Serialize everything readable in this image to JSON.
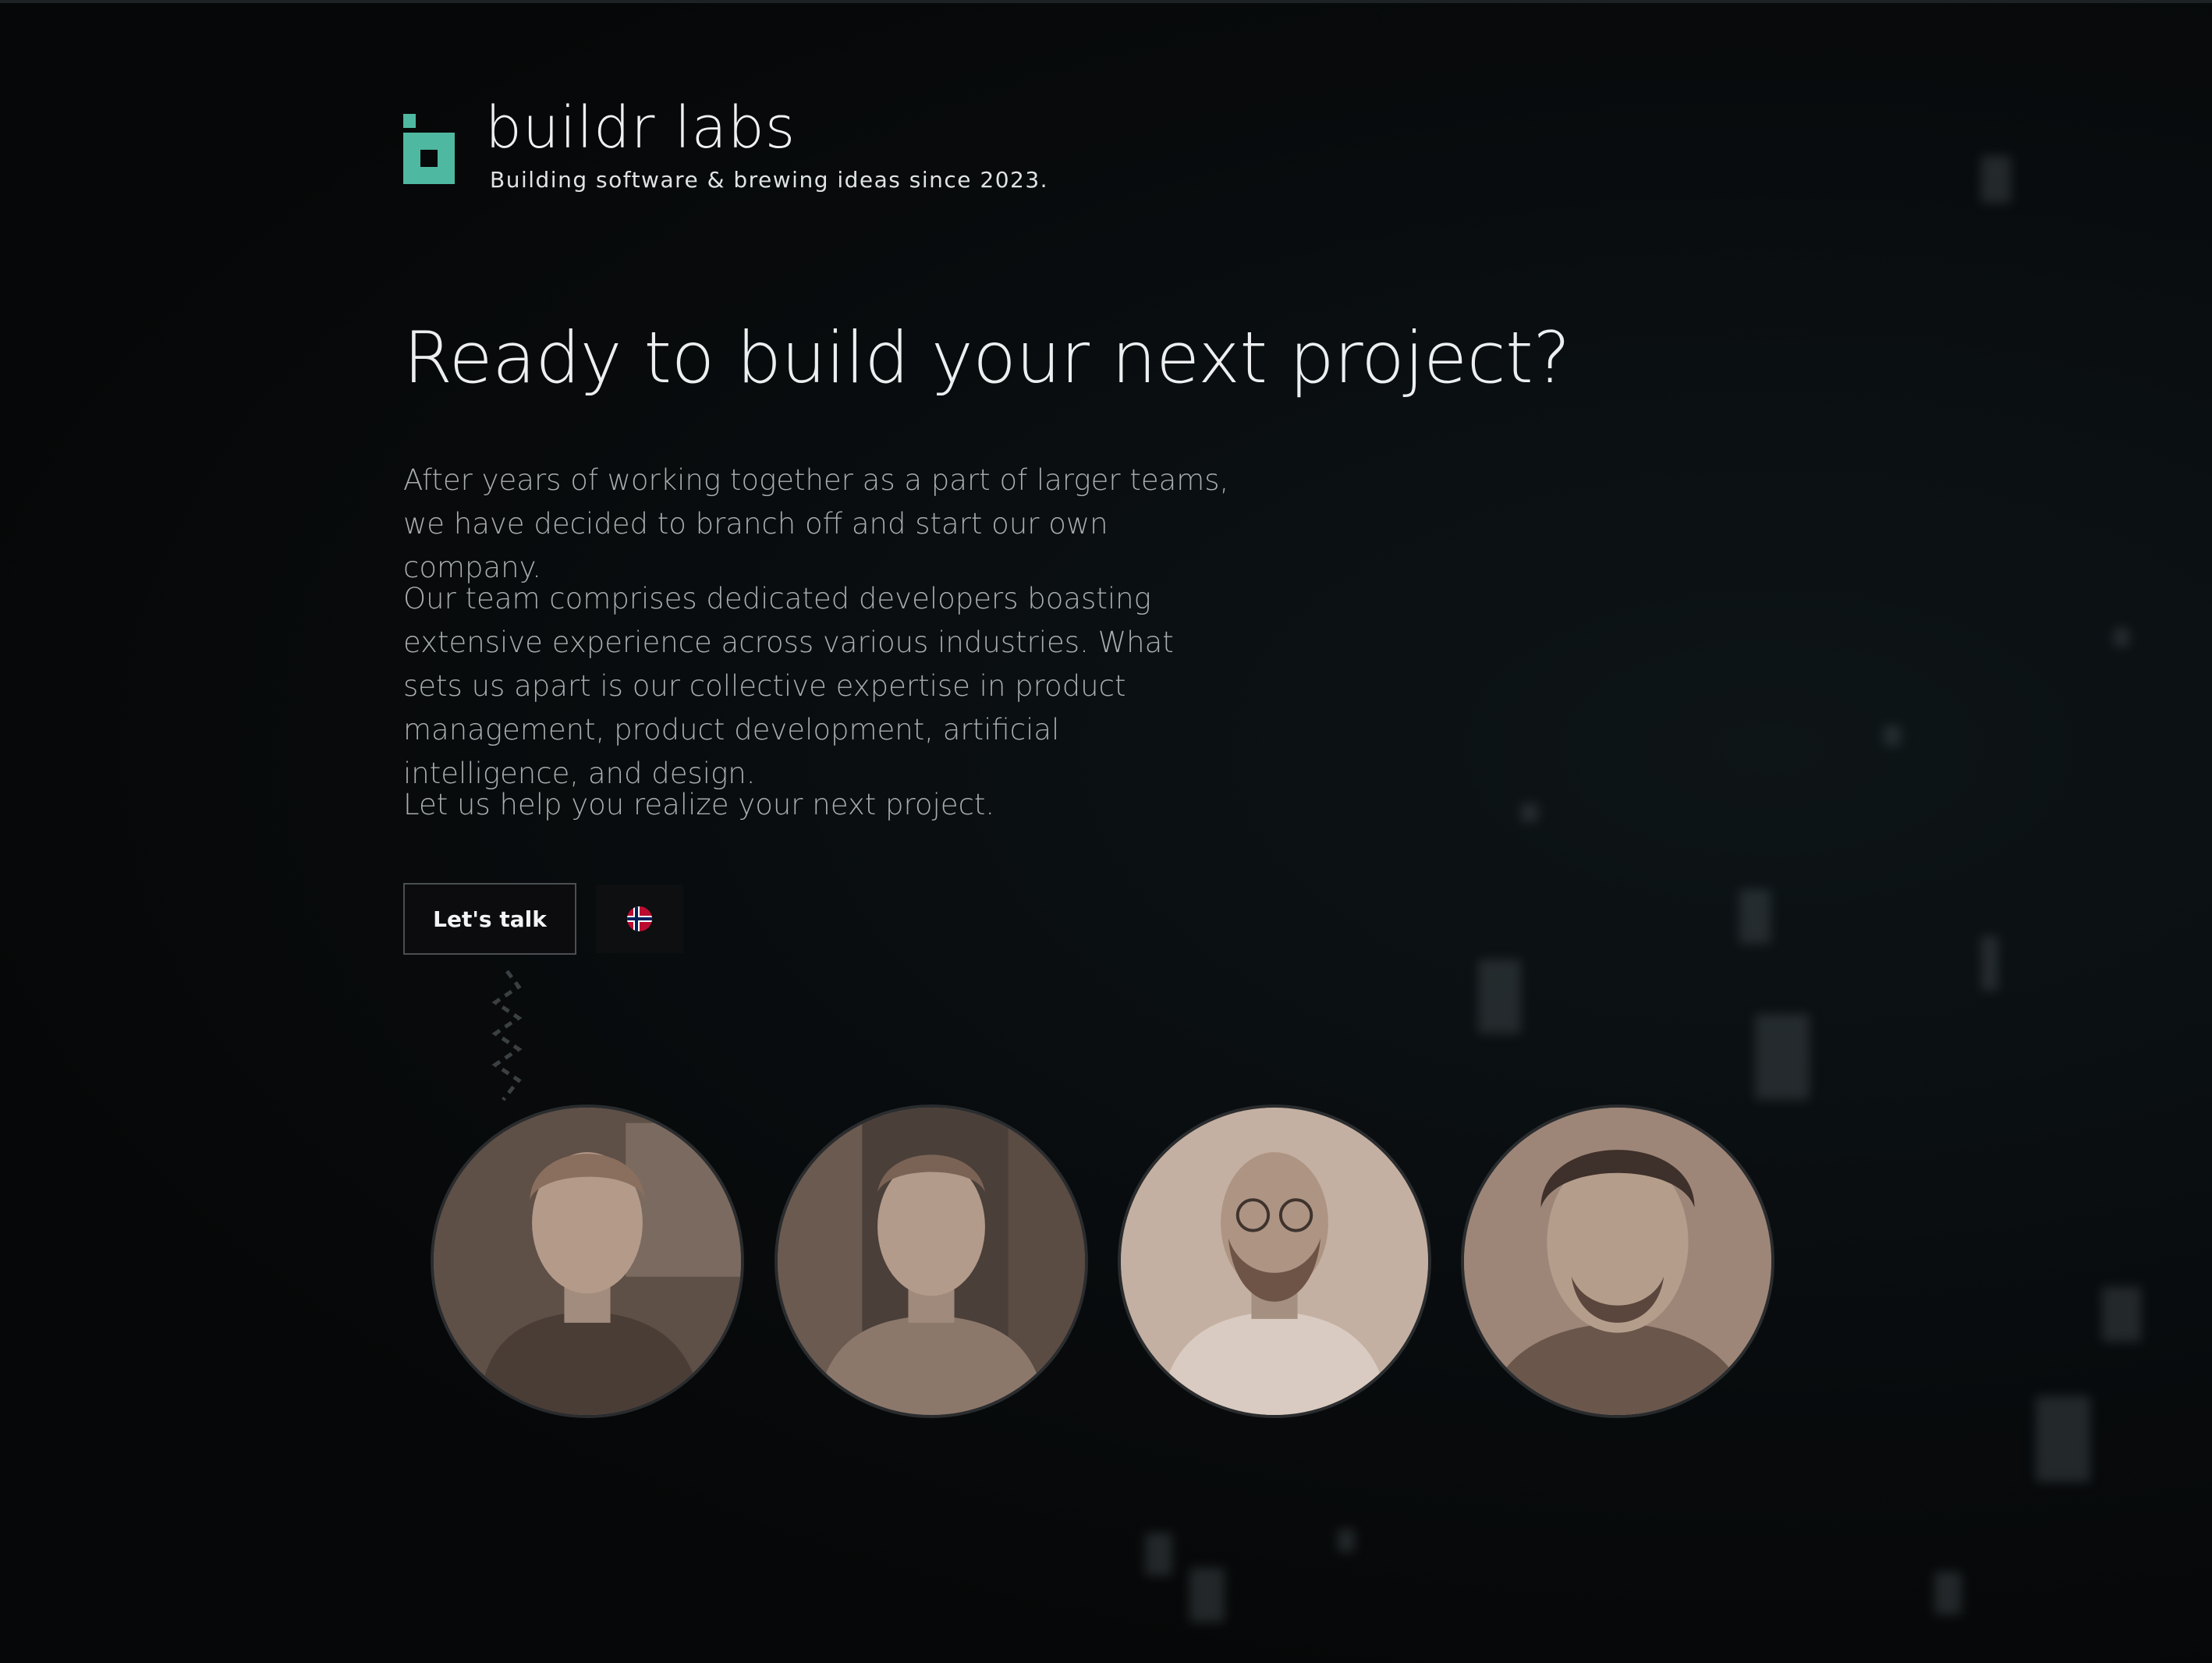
{
  "brand": {
    "name": "buildr labs",
    "tagline": "Building software & brewing ideas since 2023.",
    "accent_color": "#4fb8a0",
    "logo_icon": "buildr-logo-icon"
  },
  "hero": {
    "title": "Ready to build your next project?",
    "paragraphs": [
      "After years of working together as a part of larger teams, we have decided to branch off and start our own company.",
      "Our team comprises dedicated developers boasting extensive experience across various industries. What sets us apart is our collective expertise in product management, product development, artificial intelligence, and design.",
      "Let us help you realize your next project."
    ]
  },
  "actions": {
    "talk_label": "Let's talk",
    "language_icon": "norway-flag-icon"
  },
  "team": {
    "members": [
      {
        "icon": "team-member-photo"
      },
      {
        "icon": "team-member-photo"
      },
      {
        "icon": "team-member-photo"
      },
      {
        "icon": "team-member-photo"
      }
    ]
  },
  "colors": {
    "background": "#060809",
    "text_primary": "#eceeef",
    "text_secondary": "#a8adaf",
    "photo_tint": "#8e7c70"
  }
}
